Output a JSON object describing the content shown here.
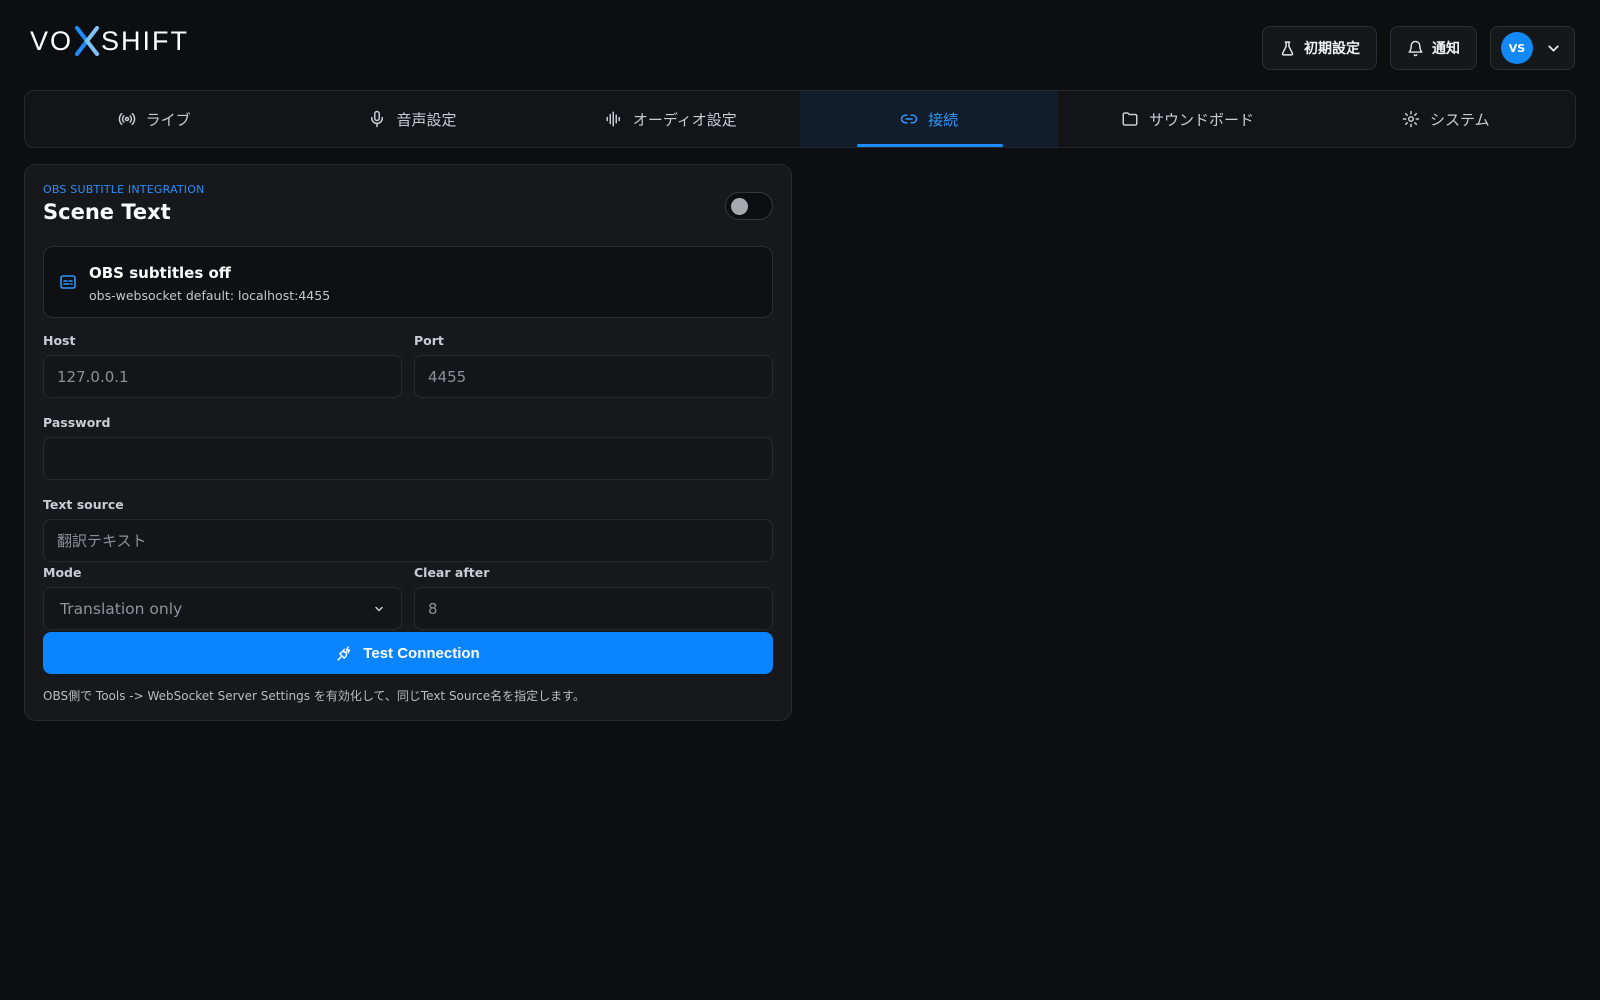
{
  "app": {
    "logo_prefix": "VO",
    "logo_suffix": "SHIFT"
  },
  "header": {
    "setup_label": "初期設定",
    "notifications_label": "通知",
    "user_initials": "VS"
  },
  "tabs": [
    {
      "label": "ライブ",
      "icon": "broadcast-icon"
    },
    {
      "label": "音声設定",
      "icon": "microphone-icon"
    },
    {
      "label": "オーディオ設定",
      "icon": "audio-wave-icon"
    },
    {
      "label": "接続",
      "icon": "link-icon",
      "active": true
    },
    {
      "label": "サウンドボード",
      "icon": "folder-icon"
    },
    {
      "label": "システム",
      "icon": "gear-icon"
    }
  ],
  "card": {
    "eyebrow": "OBS SUBTITLE INTEGRATION",
    "title": "Scene Text",
    "enabled": false,
    "status": {
      "title": "OBS subtitles off",
      "subtitle": "obs-websocket default: localhost:4455"
    },
    "fields": {
      "host": {
        "label": "Host",
        "placeholder": "127.0.0.1"
      },
      "port": {
        "label": "Port",
        "placeholder": "4455"
      },
      "password": {
        "label": "Password",
        "placeholder": ""
      },
      "text_source": {
        "label": "Text source",
        "placeholder": "翻訳テキスト"
      },
      "mode": {
        "label": "Mode",
        "value": "Translation only"
      },
      "clear_after": {
        "label": "Clear after",
        "placeholder": "8"
      }
    },
    "test_button": "Test Connection",
    "hint": "OBS側で Tools -> WebSocket Server Settings を有効化して、同じText Source名を指定します。"
  },
  "colors": {
    "accent": "#0a84ff",
    "background": "#0d0e11",
    "card": "#16181c"
  }
}
